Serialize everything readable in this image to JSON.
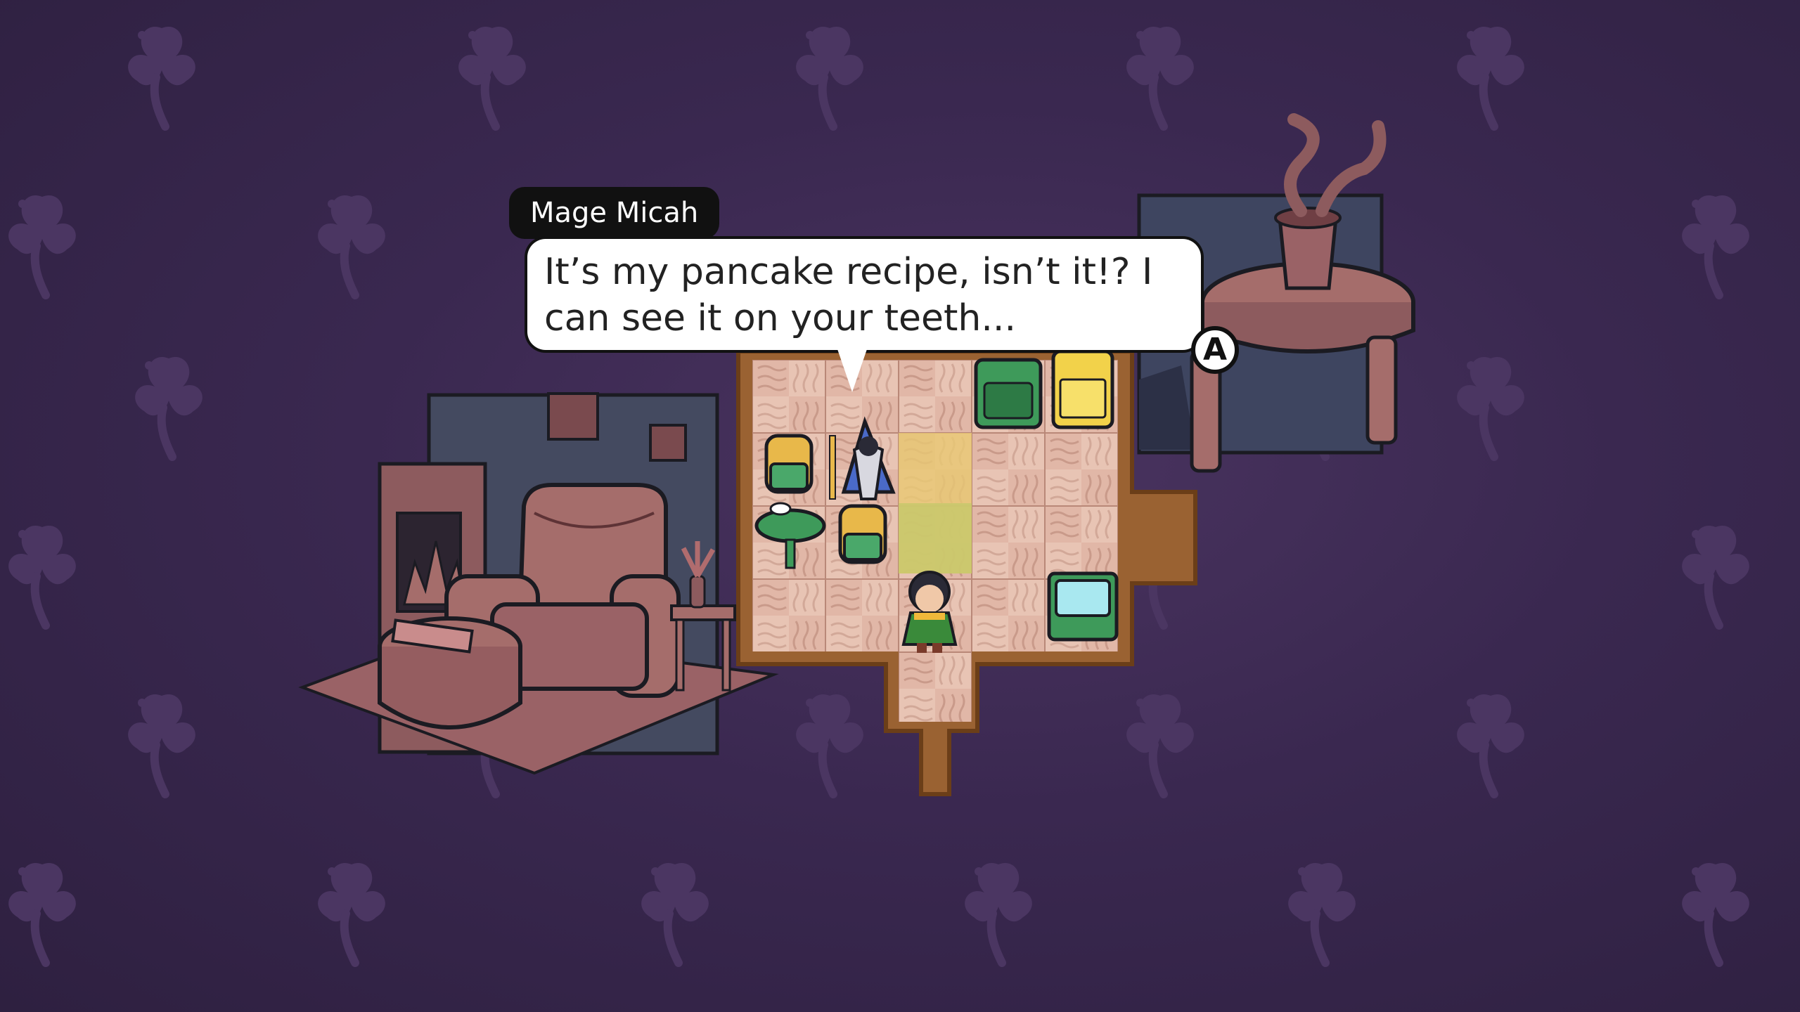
{
  "dialog": {
    "speaker": "Mage Micah",
    "text": "It’s my pancake recipe, isn’t it!? I can see it on your teeth...",
    "prompt_button": "A"
  },
  "colors": {
    "background": "#3a2850",
    "flower": "#4a3562",
    "floor_light": "#e9c8b8",
    "floor_mid": "#d8a596",
    "floor_border": "#9a6232",
    "furniture": "#a56d6b",
    "furniture_dark": "#6f3f44",
    "wall": "#454b62"
  },
  "icons": {
    "prompt": "a-button-icon",
    "player": "girl-hero-sprite",
    "npc": "mage-npc-sprite"
  }
}
